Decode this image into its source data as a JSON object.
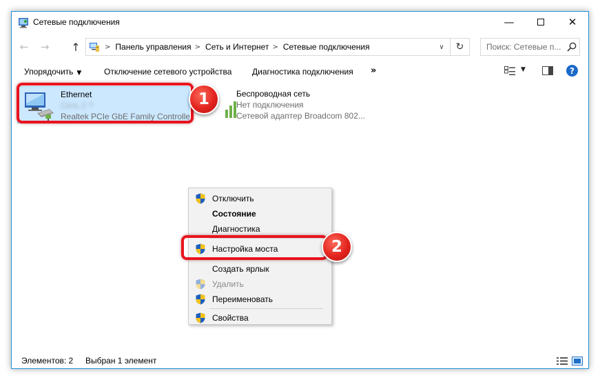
{
  "window": {
    "title": "Сетевые подключения",
    "controls": {
      "minimize": "—",
      "close": "✕"
    }
  },
  "nav": {
    "back": "←",
    "forward": "→",
    "up": "↑",
    "breadcrumbs": [
      "Панель управления",
      "Сеть и Интернет",
      "Сетевые подключения"
    ],
    "separator": ">",
    "dropdown": "∨",
    "refresh": "↻",
    "search_placeholder": "Поиск: Сетевые п..."
  },
  "toolbar": {
    "organize": "Упорядочить",
    "organize_arrow": "▼",
    "disable_device": "Отключение сетевого устройства",
    "diagnostics": "Диагностика подключения",
    "more": "»",
    "view_dropdown": "▼",
    "help": "?"
  },
  "connections": [
    {
      "name": "Ethernet",
      "status": "Сеть  2  ?",
      "device": "Realtek PCIe GbE Family Controller",
      "selected": true
    },
    {
      "name": "Беспроводная сеть",
      "status": "Нет подключения",
      "device": "Сетевой адаптер Broadcom 802...",
      "selected": false
    }
  ],
  "context_menu": {
    "items": [
      {
        "label": "Отключить",
        "shield": true,
        "bold": false,
        "disabled": false
      },
      {
        "label": "Состояние",
        "shield": false,
        "bold": true,
        "disabled": false
      },
      {
        "label": "Диагностика",
        "shield": false,
        "bold": false,
        "disabled": false
      },
      {
        "label": "Настройка моста",
        "shield": true,
        "bold": false,
        "disabled": false
      },
      {
        "label": "Создать ярлык",
        "shield": false,
        "bold": false,
        "disabled": false
      },
      {
        "label": "Удалить",
        "shield": true,
        "bold": false,
        "disabled": true
      },
      {
        "label": "Переименовать",
        "shield": true,
        "bold": false,
        "disabled": false
      },
      {
        "label": "Свойства",
        "shield": true,
        "bold": false,
        "disabled": false
      }
    ]
  },
  "status_bar": {
    "count": "Элементов: 2",
    "selected": "Выбран 1 элемент"
  },
  "annotations": {
    "badge_1": "1",
    "badge_2": "2",
    "color": "#e8141e"
  },
  "colors": {
    "selection_bg": "#cce8ff",
    "selection_border": "#99d1ff",
    "window_border": "#1e8fd6",
    "help_blue": "#1b6ac9"
  }
}
